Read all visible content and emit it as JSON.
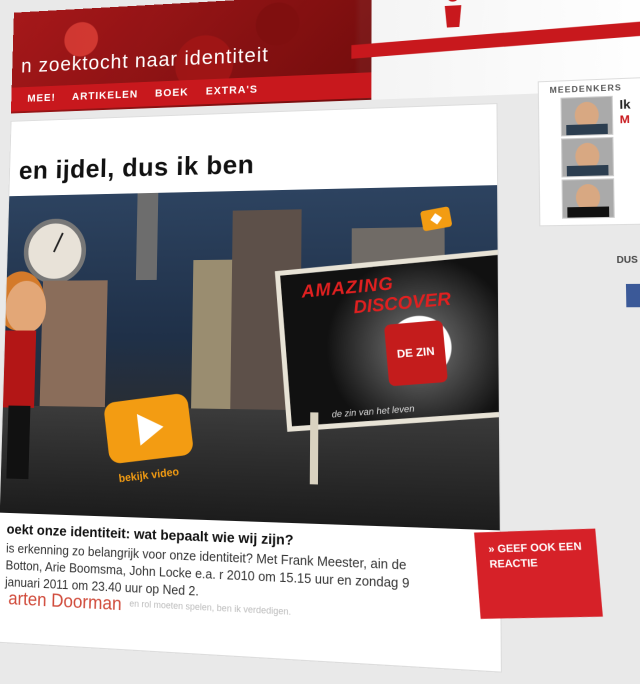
{
  "header": {
    "tagline": "n zoektocht naar identiteit",
    "top_tabs": [
      "",
      ""
    ],
    "nav": [
      {
        "label": "MEE!"
      },
      {
        "label": "ARTIKELEN"
      },
      {
        "label": "BOEK"
      },
      {
        "label": "EXTRA'S"
      }
    ]
  },
  "article": {
    "title": "en ijdel, dus ik ben",
    "video": {
      "play_label": "bekijk video",
      "billboard_line1": "AMAZING",
      "billboard_line2": "DISCOVER",
      "billboard_product": "DE ZIN",
      "billboard_slogan": "de zin van het leven"
    },
    "subhead": "oekt onze identiteit: wat bepaalt wie wij zijn?",
    "body": "is erkenning zo belangrijk voor onze identiteit? Met Frank Meester, ain de Botton, Arie Boomsma, John Locke e.a. r 2010 om 15.15 uur en zondag 9 januari 2011 om 23.40 uur op Ned 2.",
    "author": "arten Doorman",
    "author_sub": "en rol moeten spelen, ben ik verdedigen.",
    "cta": "» GEEF OOK EEN REACTIE"
  },
  "sidebar": {
    "title": "MEEDENKERS",
    "people": [
      {
        "name": "Ik",
        "role": "M"
      },
      {
        "name": "",
        "role": ""
      },
      {
        "name": "",
        "role": ""
      }
    ],
    "section2_title": "DUS"
  }
}
